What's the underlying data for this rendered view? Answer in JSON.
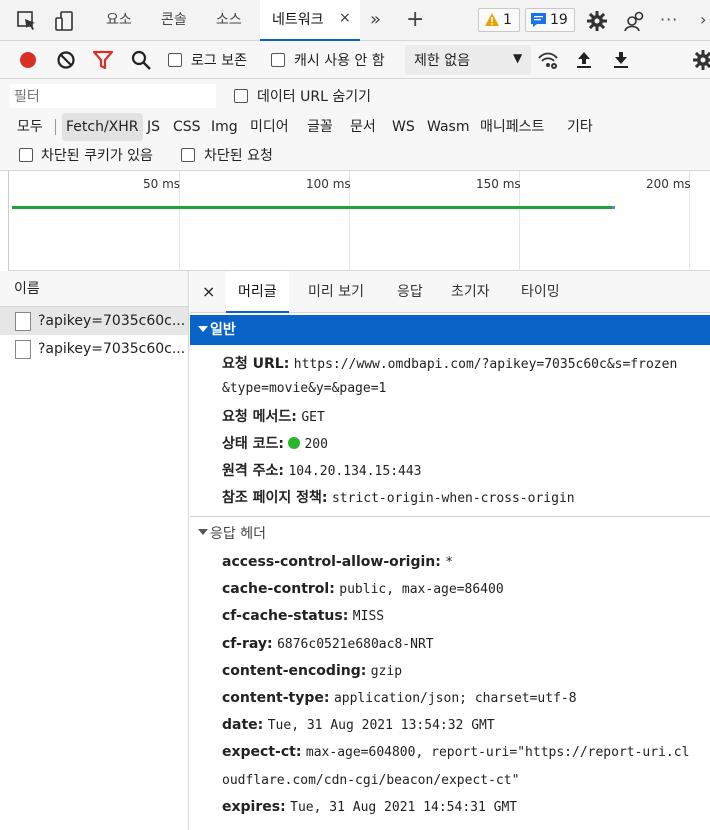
{
  "top_tabs": {
    "tabs": [
      "요소",
      "콘솔",
      "소스",
      "네트워크"
    ],
    "active": "네트워크",
    "close": "×",
    "more": "»",
    "add": "+",
    "warnings_count": "1",
    "messages_count": "19",
    "overflow": "···"
  },
  "toolbar": {
    "preserve_log": "로그 보존",
    "disable_cache": "캐시 사용 안 함",
    "throttle": "제한 없음"
  },
  "filter": {
    "placeholder": "필터",
    "hide_data_urls": "데이터 URL 숨기기",
    "types": [
      "모두",
      "Fetch/XHR",
      "JS",
      "CSS",
      "Img",
      "미디어",
      "글꼴",
      "문서",
      "WS",
      "Wasm",
      "매니페스트",
      "기타"
    ],
    "active_type": "Fetch/XHR",
    "blocked_cookies": "차단된 쿠키가 있음",
    "blocked_requests": "차단된 요청"
  },
  "timeline": {
    "ticks": [
      "50 ms",
      "100 ms",
      "150 ms",
      "200 ms"
    ]
  },
  "request_list": {
    "header": "이름",
    "items": [
      "?apikey=7035c60c...",
      "?apikey=7035c60c..."
    ]
  },
  "details": {
    "close": "×",
    "tabs": [
      "머리글",
      "미리 보기",
      "응답",
      "초기자",
      "타이밍"
    ],
    "active_tab": "머리글",
    "general_title": "일반",
    "general": {
      "url_label": "요청 URL:",
      "url_line1": "https://www.omdbapi.com/?apikey=7035c60c&s=frozen",
      "url_line2": "&type=movie&y=&page=1",
      "method_label": "요청 메서드:",
      "method": "GET",
      "status_label": "상태 코드:",
      "status": "200",
      "remote_label": "원격 주소:",
      "remote": "104.20.134.15:443",
      "referrer_label": "참조 페이지 정책:",
      "referrer": "strict-origin-when-cross-origin"
    },
    "response_headers_title": "응답 헤더",
    "response_headers": [
      {
        "k": "access-control-allow-origin:",
        "v": "*"
      },
      {
        "k": "cache-control:",
        "v": "public, max-age=86400"
      },
      {
        "k": "cf-cache-status:",
        "v": "MISS"
      },
      {
        "k": "cf-ray:",
        "v": "6876c0521e680ac8-NRT"
      },
      {
        "k": "content-encoding:",
        "v": "gzip"
      },
      {
        "k": "content-type:",
        "v": "application/json; charset=utf-8"
      },
      {
        "k": "date:",
        "v": "Tue, 31 Aug 2021 13:54:32 GMT"
      },
      {
        "k": "expect-ct:",
        "v": "max-age=604800, report-uri=\"https://report-uri.cl"
      },
      {
        "k": "",
        "v": "oudflare.com/cdn-cgi/beacon/expect-ct\""
      },
      {
        "k": "expires:",
        "v": "Tue, 31 Aug 2021 14:54:31 GMT"
      }
    ]
  },
  "colors": {
    "accent": "#0a64c8",
    "record": "#d93025",
    "filter_icon": "#d93025",
    "status_ok": "#2bb52b",
    "timeline_bar": "#21a33b"
  }
}
